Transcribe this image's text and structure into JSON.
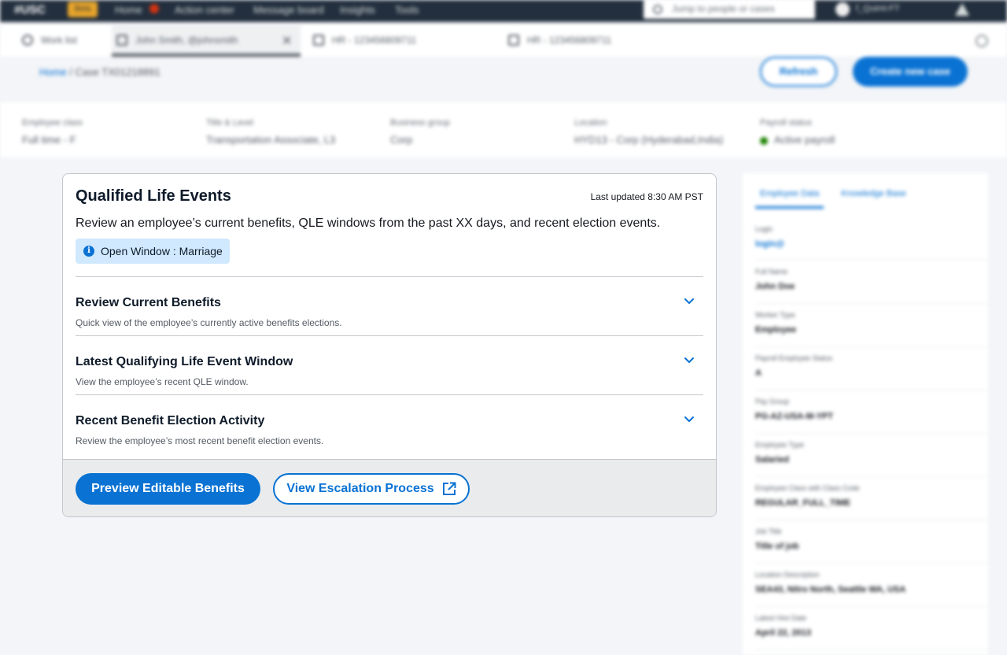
{
  "topbar": {
    "logo": "#USC",
    "beta_label": "Beta",
    "nav_items": [
      "Home",
      "Action center",
      "Message board",
      "Insights",
      "Tools"
    ],
    "search_placeholder": "Jump to people or cases",
    "user_label": "f_Quimt-FT"
  },
  "tabs": {
    "work_list": "Work list",
    "active_tab": "John Smith, @johnsmith",
    "tab2": "HR - 123456809711",
    "tab3": "HR - 123456809711"
  },
  "header": {
    "breadcrumb_home": "Home",
    "breadcrumb_rest": " / Case TX01218891",
    "refresh_label": "Refresh",
    "create_label": "Create new case"
  },
  "info_strip": [
    {
      "label": "Employee class",
      "value": "Full time - F"
    },
    {
      "label": "Title & Level",
      "value": "Transportation Associate, L3"
    },
    {
      "label": "Business group",
      "value": "Corp"
    },
    {
      "label": "Location",
      "value": "HYD13 - Corp (Hyderabad,India)"
    },
    {
      "label": "Payroll status",
      "value": "Active payroll"
    }
  ],
  "qle_card": {
    "title": "Qualified Life Events",
    "last_updated": "Last updated 8:30 AM PST",
    "description": "Review an employee’s current benefits, QLE windows from the past XX days, and recent election events.",
    "window_pill": "Open Window : Marriage",
    "info_icon_glyph": "i",
    "sections": [
      {
        "title": "Review Current Benefits",
        "subtitle": "Quick view of the employee’s currently active benefits elections."
      },
      {
        "title": "Latest Qualifying Life Event Window",
        "subtitle": "View the employee’s recent QLE window."
      },
      {
        "title": "Recent Benefit Election Activity",
        "subtitle": "Review the employee’s most recent benefit election events."
      }
    ],
    "primary_button": "Preview Editable Benefits",
    "secondary_button": "View Escalation Process"
  },
  "right_panel": {
    "tabs": [
      "Employee Data",
      "Knowledge Base"
    ],
    "fields": [
      {
        "label": "Login",
        "value": "login@"
      },
      {
        "label": "Full Name",
        "value": "John Doe"
      },
      {
        "label": "Worker Type",
        "value": "Employee"
      },
      {
        "label": "Payroll Employee Status",
        "value": "A"
      },
      {
        "label": "Pay Group",
        "value": "PG-AZ-USA-M-YPT"
      },
      {
        "label": "Employee Type",
        "value": "Salaried"
      },
      {
        "label": "Employee Class with Class Code",
        "value": "REGULAR_FULL_TIME"
      },
      {
        "label": "Job Title",
        "value": "Title of job"
      },
      {
        "label": "Location Description",
        "value": "SEA43, Nitro North, Seattle WA, USA"
      },
      {
        "label": "Latest Hire Date",
        "value": "April 22, 2013"
      }
    ]
  },
  "colors": {
    "accent": "#0972d3",
    "pill_bg": "#d1e9ff",
    "topbar": "#232f3e"
  }
}
